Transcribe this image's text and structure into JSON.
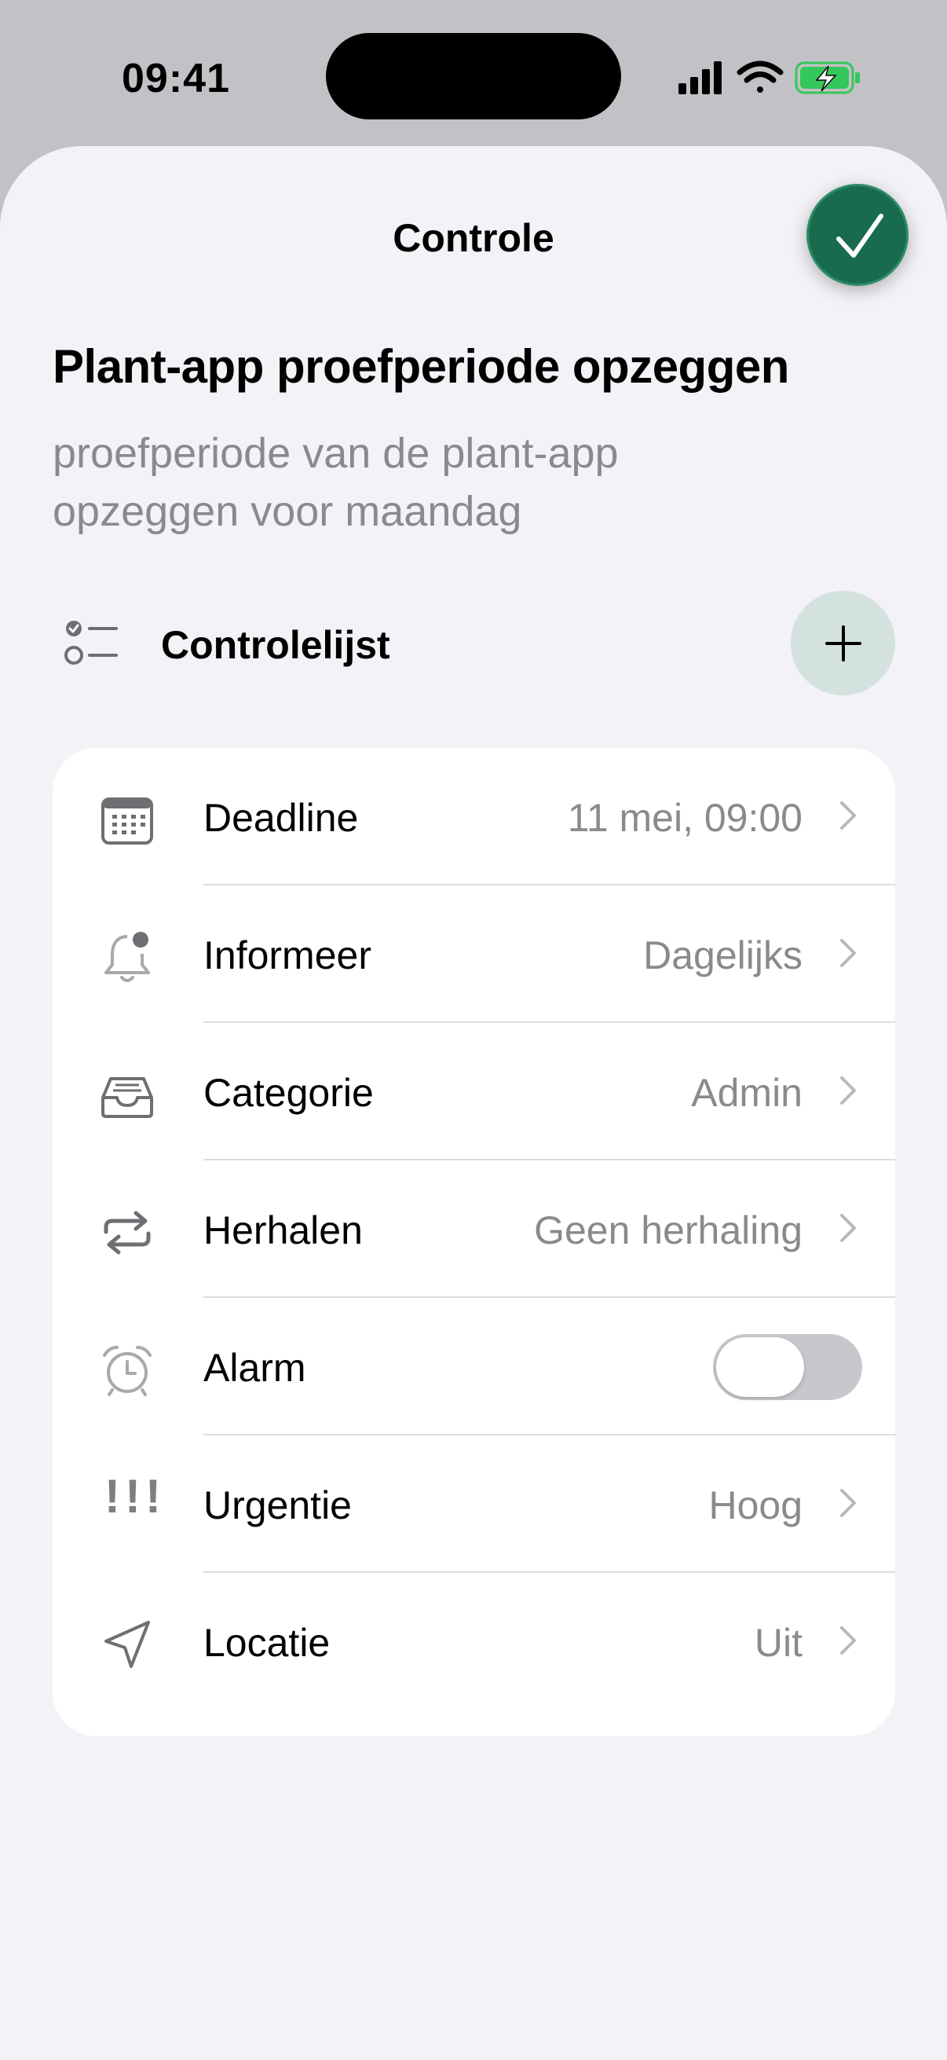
{
  "status_bar": {
    "time": "09:41",
    "icons": [
      "cellular-signal-icon",
      "wifi-icon",
      "battery-charging-icon"
    ]
  },
  "sheet": {
    "title": "Controle",
    "confirm_icon": "checkmark-icon"
  },
  "task": {
    "title": "Plant-app proefperiode opzeggen",
    "notes": "proefperiode van de plant-app opzeggen voor maandag"
  },
  "checklist": {
    "label": "Controlelijst",
    "icon": "checklist-icon",
    "add_icon": "plus-icon"
  },
  "settings": [
    {
      "key": "deadline",
      "icon": "calendar-icon",
      "label": "Deadline",
      "value": "11 mei, 09:00"
    },
    {
      "key": "informeer",
      "icon": "bell-badge-icon",
      "label": "Informeer",
      "value": "Dagelijks"
    },
    {
      "key": "categorie",
      "icon": "tray-icon",
      "label": "Categorie",
      "value": "Admin"
    },
    {
      "key": "herhalen",
      "icon": "repeat-icon",
      "label": "Herhalen",
      "value": "Geen herhaling"
    },
    {
      "key": "alarm",
      "icon": "alarm-clock-icon",
      "label": "Alarm",
      "toggle_on": false
    },
    {
      "key": "urgentie",
      "icon": "exclamation-icon",
      "label": "Urgentie",
      "value": "Hoog",
      "glyph": "!!!"
    },
    {
      "key": "locatie",
      "icon": "location-arrow-icon",
      "label": "Locatie",
      "value": "Uit"
    }
  ],
  "colors": {
    "accent_green": "#186b4d",
    "add_button_bg": "#d3e2df",
    "secondary_text": "#8a8a8e",
    "sheet_bg": "#f2f2f7",
    "battery_green": "#34c759"
  }
}
